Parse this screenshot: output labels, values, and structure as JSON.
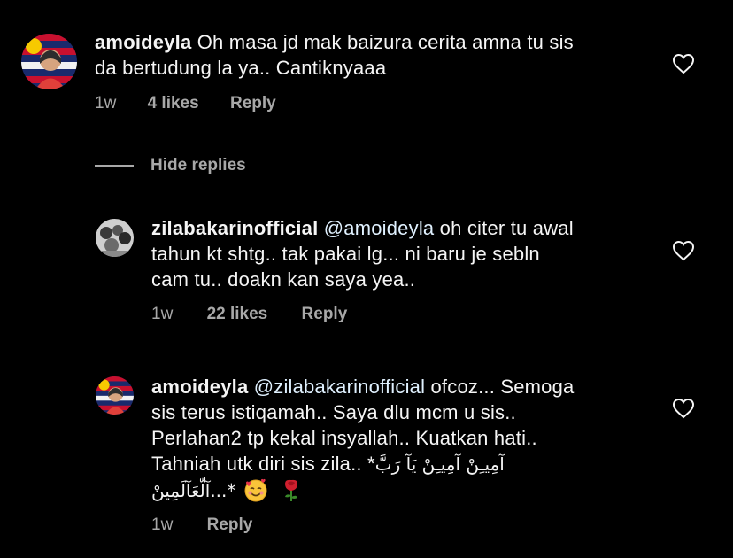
{
  "comments": [
    {
      "username": "amoideyla",
      "text_line1": "Oh masa jd mak baizura cerita amna tu sis",
      "text_line2": "da bertudung la ya.. Cantiknyaaa",
      "time": "1w",
      "likes": "4 likes",
      "reply": "Reply",
      "avatar_icon": "profile-photo-flag-icon"
    },
    {
      "username": "zilabakarinofficial",
      "mention": "@amoideyla",
      "text_line1": "oh citer tu awal",
      "text_line2": "tahun kt shtg.. tak pakai lg... ni baru je sebln",
      "text_line3": "cam tu.. doakn kan saya yea..",
      "time": "1w",
      "likes": "22 likes",
      "reply": "Reply",
      "avatar_icon": "profile-photo-group-icon"
    },
    {
      "username": "amoideyla",
      "mention": "@zilabakarinofficial",
      "text_line1": "ofcoz... Semoga",
      "text_line2": "sis terus istiqamah.. Saya dlu mcm u sis..",
      "text_line3": "Perlahan2 tp kekal insyallah.. Kuatkan hati..",
      "text_line4a": "Tahniah utk diri sis  zila.. *",
      "text_line4b": "آمِيـِنْ آمِيـِنْ يَآ رَبَّ",
      "text_line5a": "آلّعَآلَمِينْ...*",
      "emoji_1": "smiling-face-with-hearts",
      "emoji_2": "rose",
      "time": "1w",
      "reply": "Reply",
      "avatar_icon": "profile-photo-flag-icon"
    }
  ],
  "hide_replies": "Hide replies",
  "colors": {
    "background": "#000000",
    "text": "#f5f5f5",
    "meta": "#a8a8a8",
    "mention": "#e0f1ff"
  }
}
